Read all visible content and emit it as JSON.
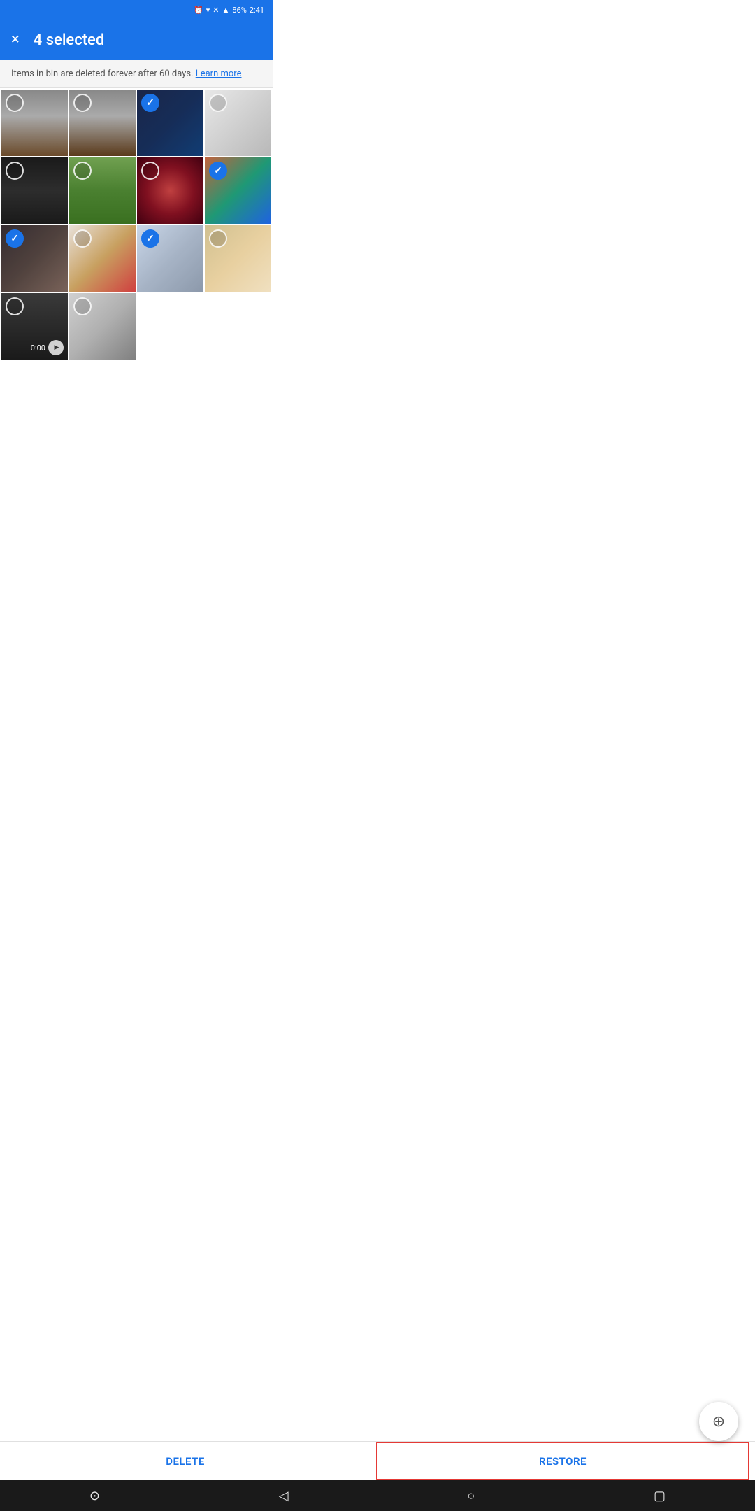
{
  "statusBar": {
    "time": "2:41",
    "battery": "86%",
    "icons": [
      "alarm",
      "wifi",
      "signal-x",
      "signal"
    ]
  },
  "topBar": {
    "closeLabel": "×",
    "selectedText": "4 selected"
  },
  "infoBar": {
    "message": "Items in bin are deleted forever after 60 days.",
    "learnMoreLabel": "Learn more"
  },
  "photos": [
    {
      "id": 1,
      "colorClass": "photo-dog1",
      "selected": false,
      "isVideo": false
    },
    {
      "id": 2,
      "colorClass": "photo-dog2",
      "selected": false,
      "isVideo": false
    },
    {
      "id": 3,
      "colorClass": "photo-screen1",
      "selected": true,
      "isVideo": false
    },
    {
      "id": 4,
      "colorClass": "photo-screen2",
      "selected": false,
      "isVideo": false
    },
    {
      "id": 5,
      "colorClass": "photo-woman",
      "selected": false,
      "isVideo": false
    },
    {
      "id": 6,
      "colorClass": "photo-feet",
      "selected": false,
      "isVideo": false
    },
    {
      "id": 7,
      "colorClass": "photo-rain",
      "selected": false,
      "isVideo": false
    },
    {
      "id": 8,
      "colorClass": "photo-hands",
      "selected": true,
      "isVideo": false
    },
    {
      "id": 9,
      "colorClass": "photo-cake",
      "selected": true,
      "isVideo": false
    },
    {
      "id": 10,
      "colorClass": "photo-icecream",
      "selected": false,
      "isVideo": false
    },
    {
      "id": 11,
      "colorClass": "photo-phone",
      "selected": true,
      "isVideo": false
    },
    {
      "id": 12,
      "colorClass": "photo-boy",
      "selected": false,
      "isVideo": false
    },
    {
      "id": 13,
      "colorClass": "photo-laptop1",
      "selected": false,
      "isVideo": true,
      "videoDuration": "0:00"
    },
    {
      "id": 14,
      "colorClass": "photo-laptop2",
      "selected": false,
      "isVideo": false
    }
  ],
  "fab": {
    "icon": "⊕",
    "label": "zoom-in"
  },
  "bottomBar": {
    "deleteLabel": "DELETE",
    "restoreLabel": "RESTORE"
  },
  "navBar": {
    "homeIcon": "⊙",
    "backIcon": "◁",
    "circleIcon": "○",
    "squareIcon": "▢"
  }
}
